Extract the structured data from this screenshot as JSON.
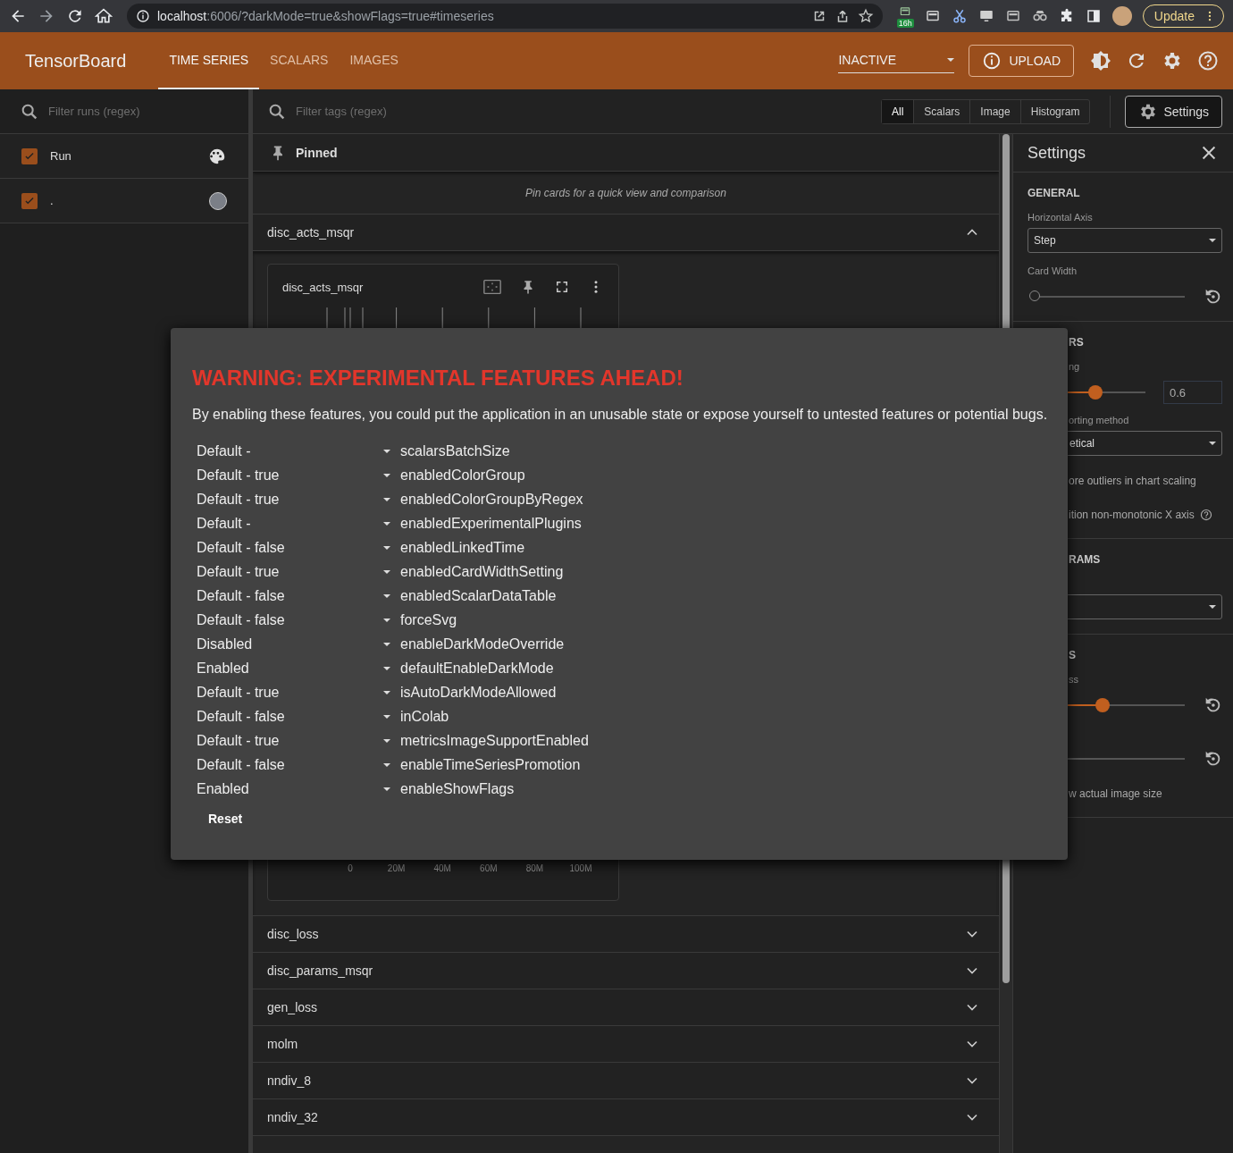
{
  "browser": {
    "address_host": "localhost",
    "address_path": ":6006/?darkMode=true&showFlags=true#timeseries",
    "extension_badge": "16h",
    "update_button": "Update"
  },
  "header": {
    "title": "TensorBoard",
    "tabs": [
      {
        "label": "TIME SERIES",
        "selected": true
      },
      {
        "label": "SCALARS",
        "selected": false
      },
      {
        "label": "IMAGES",
        "selected": false
      }
    ],
    "reload_mode": "INACTIVE",
    "upload_button": "UPLOAD"
  },
  "runs_panel": {
    "filter_placeholder": "Filter runs (regex)",
    "header": {
      "label": "Run",
      "checked": true
    },
    "runs": [
      {
        "name": ".",
        "checked": true,
        "color": "#7b7f87"
      }
    ]
  },
  "main": {
    "filter_placeholder": "Filter tags (regex)",
    "type_filters": [
      {
        "label": "All",
        "selected": true
      },
      {
        "label": "Scalars",
        "selected": false
      },
      {
        "label": "Image",
        "selected": false
      },
      {
        "label": "Histogram",
        "selected": false
      }
    ],
    "settings_button": "Settings",
    "pinned": {
      "title": "Pinned",
      "empty_message": "Pin cards for a quick view and comparison"
    },
    "groups": [
      {
        "name": "disc_acts_msqr",
        "expanded": true,
        "cards": [
          {
            "title": "disc_acts_msqr",
            "x_ticks": [
              "0",
              "20M",
              "40M",
              "60M",
              "80M",
              "100M"
            ]
          }
        ]
      },
      {
        "name": "disc_loss",
        "expanded": false
      },
      {
        "name": "disc_params_msqr",
        "expanded": false
      },
      {
        "name": "gen_loss",
        "expanded": false
      },
      {
        "name": "molm",
        "expanded": false
      },
      {
        "name": "nndiv_8",
        "expanded": false
      },
      {
        "name": "nndiv_32",
        "expanded": false
      }
    ]
  },
  "settings": {
    "title": "Settings",
    "sections": [
      {
        "heading": "GENERAL",
        "covered": false,
        "items": [
          {
            "kind": "select",
            "label": "Horizontal Axis",
            "value": "Step"
          },
          {
            "kind": "slider",
            "label": "Card Width",
            "level": 0,
            "reset": true
          }
        ]
      },
      {
        "heading": "RS",
        "covered": true,
        "items": [
          {
            "kind": "slider",
            "label": "ng",
            "level": 0.6,
            "value": "0.6"
          },
          {
            "kind": "select",
            "label": "orting method",
            "value": "etical"
          },
          {
            "kind": "text",
            "label": "ore outliers in chart scaling"
          },
          {
            "kind": "text",
            "label": "ition non-monotonic X axis",
            "help": true
          }
        ]
      },
      {
        "heading": "RAMS",
        "covered": true,
        "items": [
          {
            "kind": "select"
          }
        ]
      },
      {
        "heading": "S",
        "covered": true,
        "items": [
          {
            "kind": "slider",
            "label": "ss",
            "level": 0.5,
            "reset": true
          },
          {
            "kind": "slider",
            "reset": true
          },
          {
            "kind": "text",
            "label": "w actual image size"
          }
        ]
      }
    ]
  },
  "flags_dialog": {
    "title": "WARNING: EXPERIMENTAL FEATURES AHEAD!",
    "description": "By enabling these features, you could put the application in an unusable state or expose yourself to untested features or potential bugs.",
    "flags": [
      {
        "value": "Default -",
        "name": "scalarsBatchSize"
      },
      {
        "value": "Default - true",
        "name": "enabledColorGroup"
      },
      {
        "value": "Default - true",
        "name": "enabledColorGroupByRegex"
      },
      {
        "value": "Default -",
        "name": "enabledExperimentalPlugins"
      },
      {
        "value": "Default - false",
        "name": "enabledLinkedTime"
      },
      {
        "value": "Default - true",
        "name": "enabledCardWidthSetting"
      },
      {
        "value": "Default - false",
        "name": "enabledScalarDataTable"
      },
      {
        "value": "Default - false",
        "name": "forceSvg"
      },
      {
        "value": "Disabled",
        "name": "enableDarkModeOverride"
      },
      {
        "value": "Enabled",
        "name": "defaultEnableDarkMode"
      },
      {
        "value": "Default - true",
        "name": "isAutoDarkModeAllowed"
      },
      {
        "value": "Default - false",
        "name": "inColab"
      },
      {
        "value": "Default - true",
        "name": "metricsImageSupportEnabled"
      },
      {
        "value": "Default - false",
        "name": "enableTimeSeriesPromotion"
      },
      {
        "value": "Enabled",
        "name": "enableShowFlags"
      }
    ],
    "reset_button": "Reset"
  }
}
